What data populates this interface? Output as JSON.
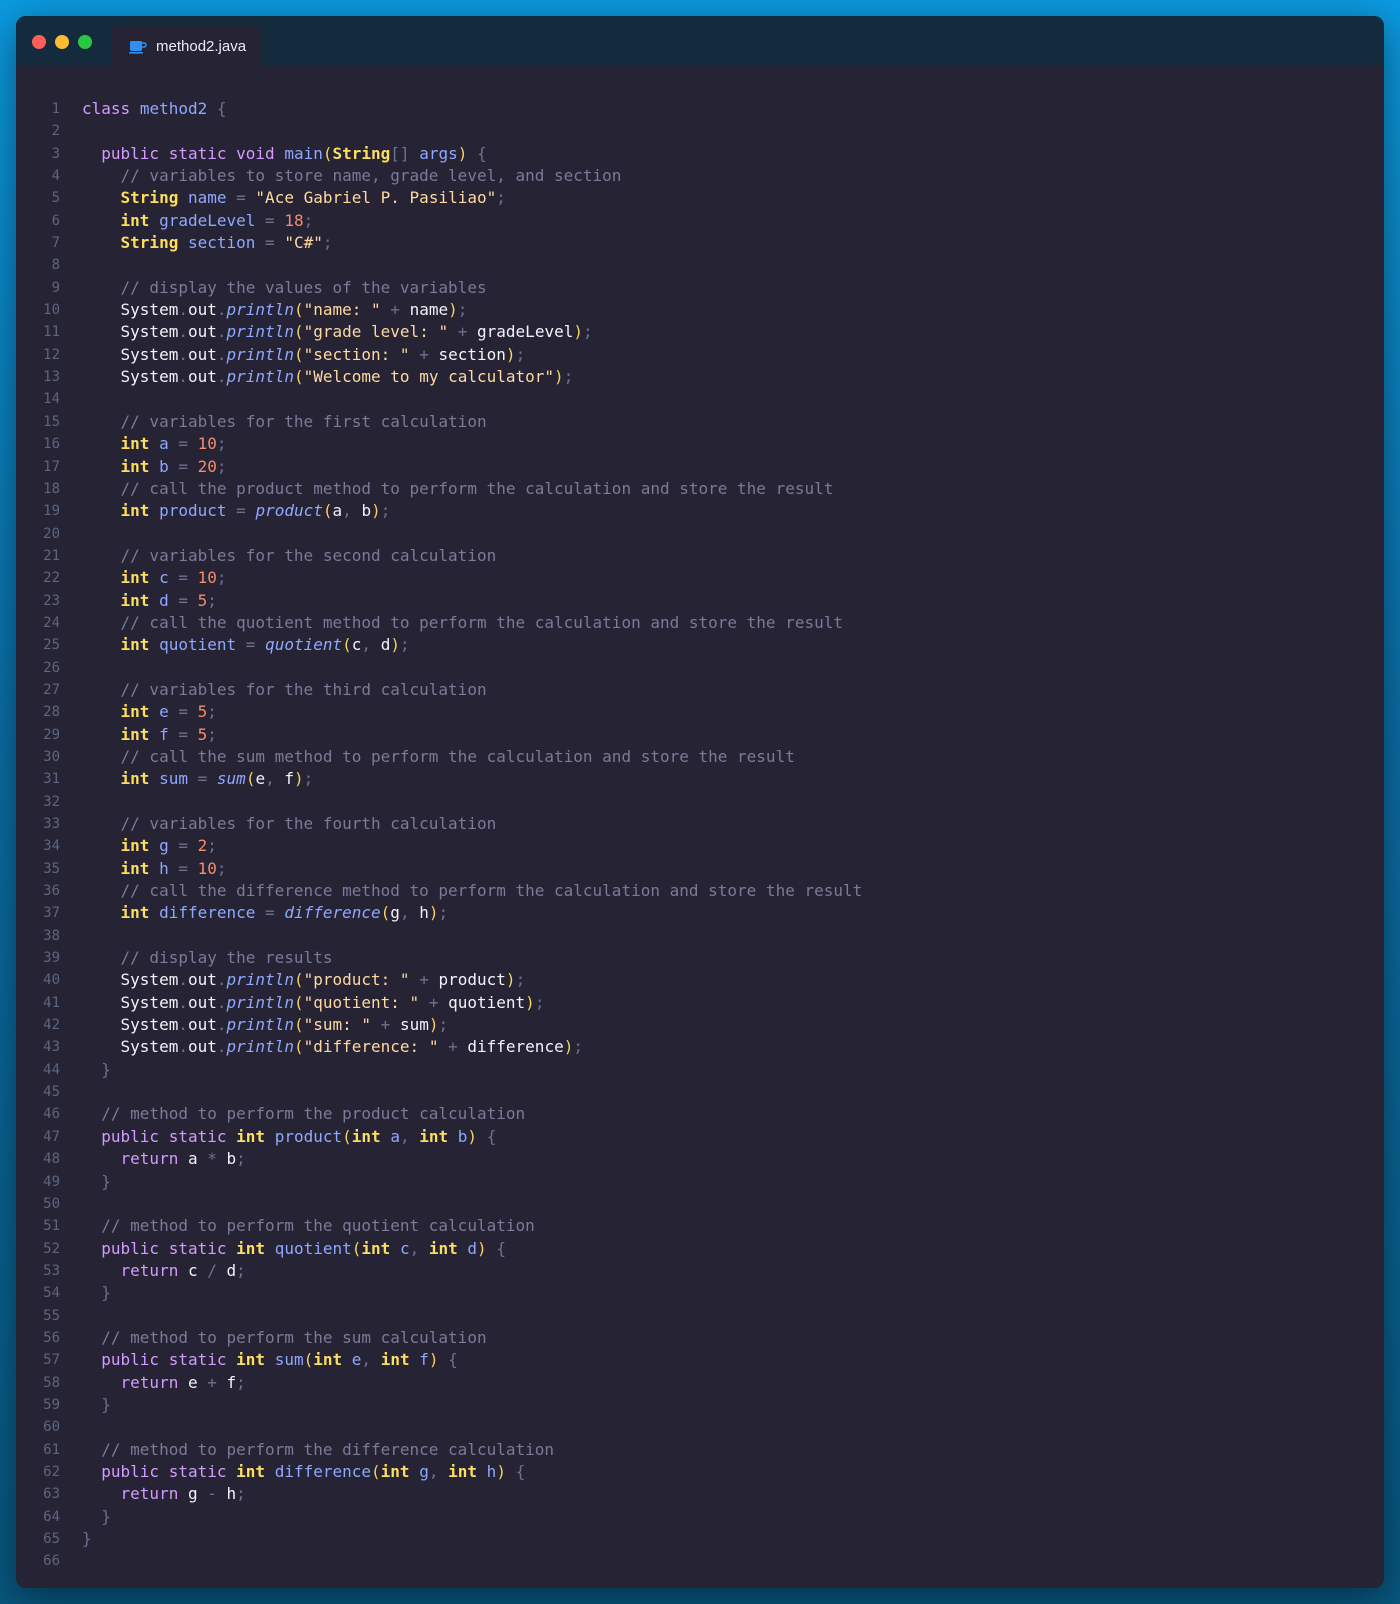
{
  "window": {
    "tab": {
      "icon": "java-cup-icon",
      "title": "method2.java"
    }
  },
  "editor": {
    "language": "java",
    "lines": [
      "class method2 {",
      "",
      "  public static void main(String[] args) {",
      "    // variables to store name, grade level, and section",
      "    String name = \"Ace Gabriel P. Pasiliao\";",
      "    int gradeLevel = 18;",
      "    String section = \"C#\";",
      "",
      "    // display the values of the variables",
      "    System.out.println(\"name: \" + name);",
      "    System.out.println(\"grade level: \" + gradeLevel);",
      "    System.out.println(\"section: \" + section);",
      "    System.out.println(\"Welcome to my calculator\");",
      "",
      "    // variables for the first calculation",
      "    int a = 10;",
      "    int b = 20;",
      "    // call the product method to perform the calculation and store the result",
      "    int product = product(a, b);",
      "",
      "    // variables for the second calculation",
      "    int c = 10;",
      "    int d = 5;",
      "    // call the quotient method to perform the calculation and store the result",
      "    int quotient = quotient(c, d);",
      "",
      "    // variables for the third calculation",
      "    int e = 5;",
      "    int f = 5;",
      "    // call the sum method to perform the calculation and store the result",
      "    int sum = sum(e, f);",
      "",
      "    // variables for the fourth calculation",
      "    int g = 2;",
      "    int h = 10;",
      "    // call the difference method to perform the calculation and store the result",
      "    int difference = difference(g, h);",
      "",
      "    // display the results",
      "    System.out.println(\"product: \" + product);",
      "    System.out.println(\"quotient: \" + quotient);",
      "    System.out.println(\"sum: \" + sum);",
      "    System.out.println(\"difference: \" + difference);",
      "  }",
      "",
      "  // method to perform the product calculation",
      "  public static int product(int a, int b) {",
      "    return a * b;",
      "  }",
      "",
      "  // method to perform the quotient calculation",
      "  public static int quotient(int c, int d) {",
      "    return c / d;",
      "  }",
      "",
      "  // method to perform the sum calculation",
      "  public static int sum(int e, int f) {",
      "    return e + f;",
      "  }",
      "",
      "  // method to perform the difference calculation",
      "  public static int difference(int g, int h) {",
      "    return g - h;",
      "  }",
      "}",
      ""
    ]
  }
}
